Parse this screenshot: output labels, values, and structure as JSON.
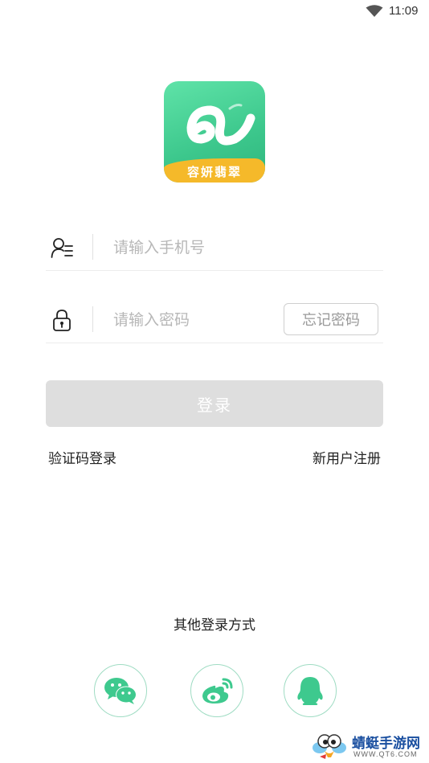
{
  "status_bar": {
    "time": "11:09",
    "wifi_icon": "wifi-icon"
  },
  "logo": {
    "text": "容妍翡翠",
    "icon": "app-logo-icon"
  },
  "form": {
    "phone": {
      "placeholder": "请输入手机号",
      "value": "",
      "icon": "user-list-icon"
    },
    "password": {
      "placeholder": "请输入密码",
      "value": "",
      "icon": "lock-icon"
    },
    "forgot_label": "忘记密码"
  },
  "login_label": "登录",
  "links": {
    "sms_login": "验证码登录",
    "register": "新用户注册"
  },
  "other_login": {
    "title": "其他登录方式",
    "methods": [
      {
        "icon": "wechat-icon"
      },
      {
        "icon": "weibo-icon"
      },
      {
        "icon": "qq-icon"
      }
    ]
  },
  "watermark": {
    "title": "蜻蜓手游网",
    "url": "WWW.QT6.COM"
  },
  "colors": {
    "accent": "#3ec98e",
    "button_disabled": "#dedede",
    "logo_banner": "#f5b92a"
  }
}
